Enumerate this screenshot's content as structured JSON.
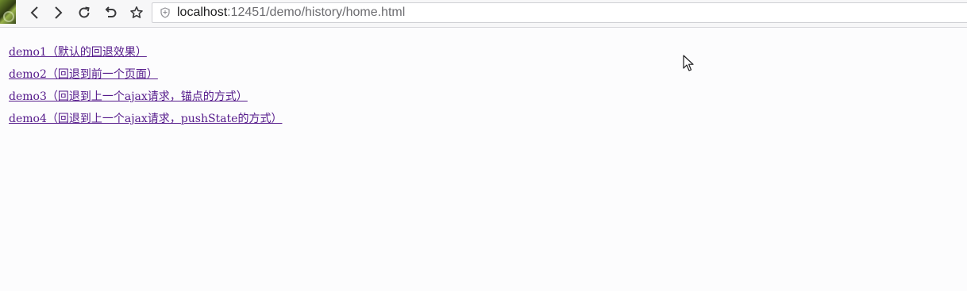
{
  "toolbar": {
    "back_icon": "chevron-left-icon",
    "forward_icon": "chevron-right-icon",
    "reload_icon": "reload-icon",
    "undo_icon": "undo-icon",
    "bookmark_icon": "star-icon",
    "security_icon": "shield-icon",
    "url_host": "localhost",
    "url_rest": ":12451/demo/history/home.html"
  },
  "links": [
    "demo1（默认的回退效果）",
    "demo2（回退到前一个页面）",
    "demo3（回退到上一个ajax请求，锚点的方式）",
    "demo4（回退到上一个ajax请求，pushState的方式）"
  ],
  "colors": {
    "link_visited": "#551a8b",
    "page_bg": "#fcfcfd"
  }
}
